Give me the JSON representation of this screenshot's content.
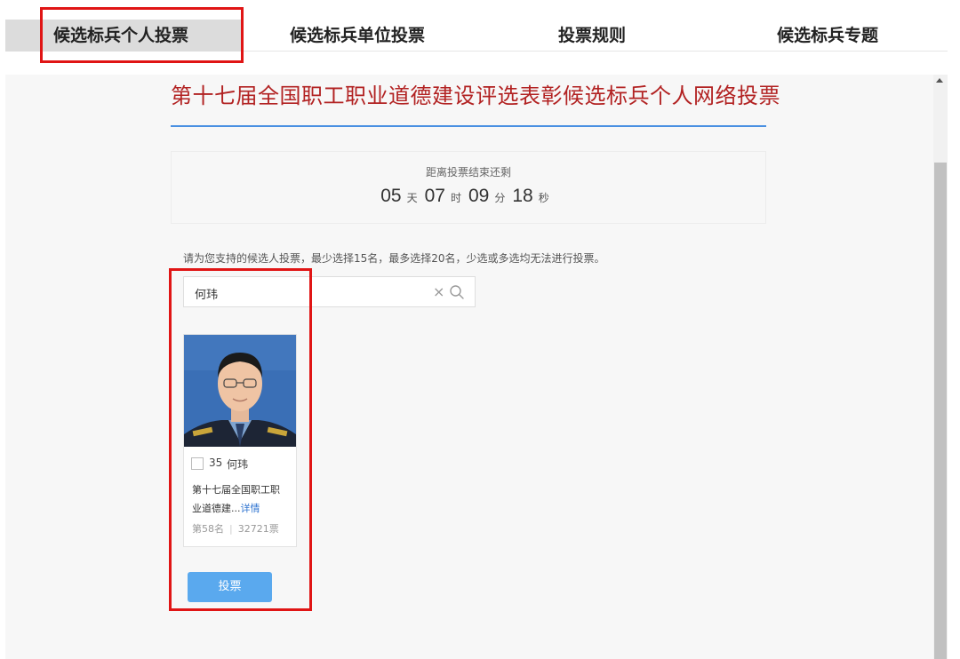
{
  "nav": {
    "tabs": [
      {
        "label": "候选标兵个人投票"
      },
      {
        "label": "候选标兵单位投票"
      },
      {
        "label": "投票规则"
      },
      {
        "label": "候选标兵专题"
      }
    ],
    "active_tab": "候选标兵个人投票"
  },
  "page": {
    "title": "第十七届全国职工职业道德建设评选表彰候选标兵个人网络投票"
  },
  "countdown": {
    "label": "距离投票结束还剩",
    "days": "05",
    "days_unit": "天",
    "hours": "07",
    "hours_unit": "时",
    "minutes": "09",
    "minutes_unit": "分",
    "seconds": "18",
    "seconds_unit": "秒"
  },
  "instruction": "请为您支持的候选人投票，最少选择15名，最多选择20名，少选或多选均无法进行投票。",
  "search": {
    "value": "何玮",
    "clear_symbol": "×"
  },
  "candidate": {
    "number": "35",
    "name": "何玮",
    "desc_line1": "第十七届全国职工职",
    "desc_line2": "业道德建...",
    "detail_link": "详情",
    "rank": "第58名",
    "votes": "32721票"
  },
  "vote_button": "投票",
  "colors": {
    "highlight": "#e01515",
    "title": "#b22222",
    "accent_rule": "#4a90e2",
    "button": "#5aa9ee",
    "link": "#2f74d0"
  }
}
